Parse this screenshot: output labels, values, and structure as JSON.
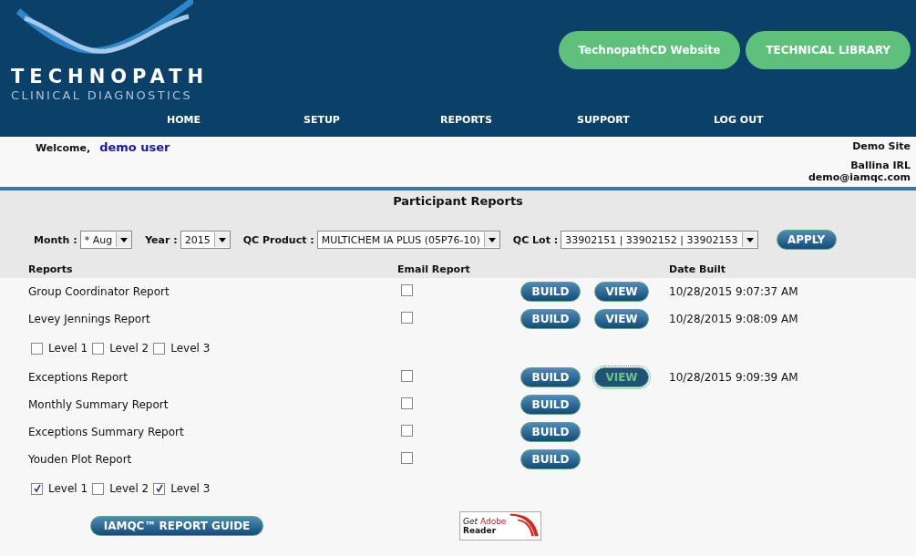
{
  "logo": {
    "name": "TECHNOPATH",
    "subtitle": "CLINICAL DIAGNOSTICS"
  },
  "header_links": [
    "TechnopathCD Website",
    "TECHNICAL LIBRARY"
  ],
  "nav": [
    "HOME",
    "SETUP",
    "REPORTS",
    "SUPPORT",
    "LOG OUT"
  ],
  "welcome": {
    "label": "Welcome,",
    "user": "demo user"
  },
  "site": {
    "name": "Demo Site",
    "location": "Ballina IRL",
    "email": "demo@iamqc.com"
  },
  "title": "Participant Reports",
  "filters": [
    {
      "label": "Month :",
      "value": "* Aug"
    },
    {
      "label": "Year :",
      "value": "2015"
    },
    {
      "label": "QC Product :",
      "value": "MULTICHEM IA PLUS (05P76-10)"
    },
    {
      "label": "QC Lot :",
      "value": "33902151 | 33902152 | 33902153"
    }
  ],
  "apply_button": "APPLY",
  "columns": [
    "Reports",
    "Email Report",
    "Date Built"
  ],
  "rows": [
    {
      "kind": "report",
      "name": "Group Coordinator Report",
      "email": false,
      "build": "BUILD",
      "view": "VIEW",
      "view_focused": false,
      "date": "10/28/2015 9:07:37 AM"
    },
    {
      "kind": "report",
      "name": "Levey Jennings Report",
      "email": false,
      "build": "BUILD",
      "view": "VIEW",
      "view_focused": false,
      "date": "10/28/2015 9:08:09 AM"
    },
    {
      "kind": "levels",
      "levels": [
        {
          "label": "Level 1",
          "checked": false
        },
        {
          "label": "Level 2",
          "checked": false
        },
        {
          "label": "Level 3",
          "checked": false
        }
      ]
    },
    {
      "kind": "report",
      "name": "Exceptions Report",
      "email": false,
      "build": "BUILD",
      "view": "VIEW",
      "view_focused": true,
      "date": "10/28/2015 9:09:39 AM"
    },
    {
      "kind": "report",
      "name": "Monthly Summary Report",
      "email": false,
      "build": "BUILD"
    },
    {
      "kind": "report",
      "name": "Exceptions Summary Report",
      "email": false,
      "build": "BUILD"
    },
    {
      "kind": "report",
      "name": "Youden Plot Report",
      "email": false,
      "build": "BUILD"
    },
    {
      "kind": "levels",
      "levels": [
        {
          "label": "Level 1",
          "checked": true
        },
        {
          "label": "Level 2",
          "checked": false
        },
        {
          "label": "Level 3",
          "checked": true
        }
      ]
    }
  ],
  "guide_button": "IAMQC™  REPORT GUIDE",
  "adobe_badge": {
    "top": "Get",
    "brand": "Adobe",
    "product": "Reader"
  }
}
